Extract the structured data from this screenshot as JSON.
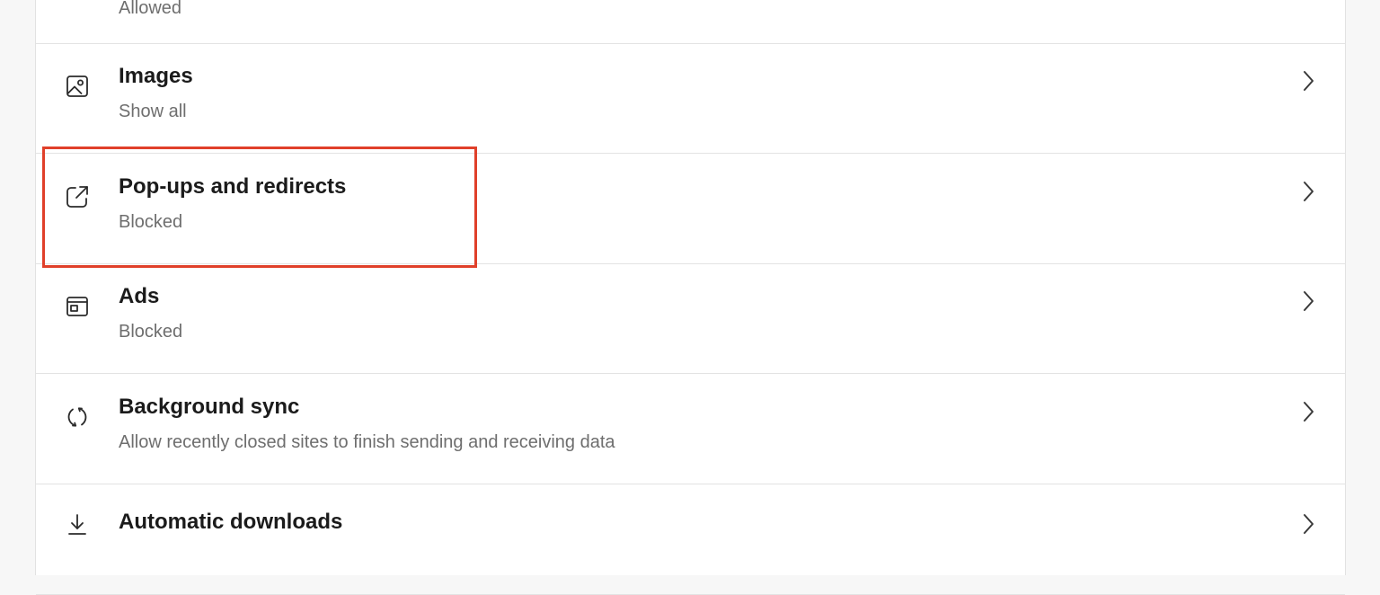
{
  "settings_list": {
    "items": [
      {
        "key": "javascript",
        "title": "",
        "subtitle": "Allowed",
        "icon": "javascript-icon"
      },
      {
        "key": "images",
        "title": "Images",
        "subtitle": "Show all",
        "icon": "image-icon"
      },
      {
        "key": "popups",
        "title": "Pop-ups and redirects",
        "subtitle": "Blocked",
        "icon": "external-link-icon"
      },
      {
        "key": "ads",
        "title": "Ads",
        "subtitle": "Blocked",
        "icon": "ads-window-icon"
      },
      {
        "key": "background_sync",
        "title": "Background sync",
        "subtitle": "Allow recently closed sites to finish sending and receiving data",
        "icon": "sync-icon"
      },
      {
        "key": "automatic_downloads",
        "title": "Automatic downloads",
        "subtitle": "",
        "icon": "download-icon"
      }
    ]
  },
  "highlight": {
    "target": "popups",
    "color": "#e0402a"
  },
  "colors": {
    "title": "#1b1b1b",
    "subtitle": "#6e6e6e",
    "divider": "#e3e3e3",
    "page_background": "#f7f7f7",
    "panel_background": "#ffffff"
  }
}
